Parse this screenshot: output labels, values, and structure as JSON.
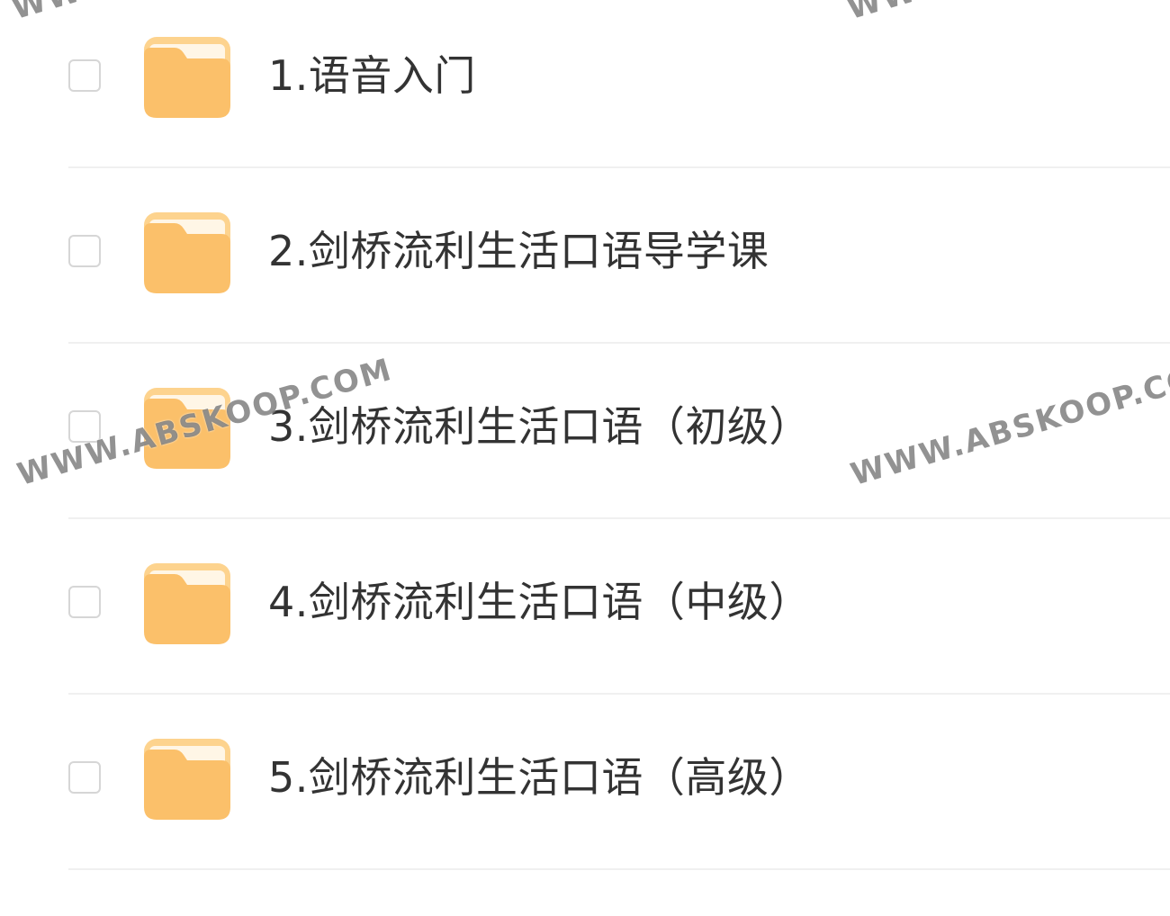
{
  "file_list": {
    "items": [
      {
        "name": "1.语音入门",
        "icon": "folder-icon",
        "checked": false
      },
      {
        "name": "2.剑桥流利生活口语导学课",
        "icon": "folder-icon",
        "checked": false
      },
      {
        "name": "3.剑桥流利生活口语（初级）",
        "icon": "folder-icon",
        "checked": false
      },
      {
        "name": "4.剑桥流利生活口语（中级）",
        "icon": "folder-icon",
        "checked": false
      },
      {
        "name": "5.剑桥流利生活口语（高级）",
        "icon": "folder-icon",
        "checked": false
      }
    ]
  },
  "watermarks": {
    "top_left": "WWW.ABSKOOP.COM",
    "top_right": "WWW.ABSKOOP.COM",
    "mid_left": "WWW.ABSKOOP.COM",
    "mid_right": "WWW.ABSKOOP.COM"
  },
  "colors": {
    "folder_body": "#FBC06A",
    "folder_tab": "#FDD38E",
    "folder_paper": "#FFF6E6",
    "text": "#333333",
    "checkbox_border": "#D6D6D6",
    "divider": "#F0F0F0",
    "watermark": "#6E6E6E"
  }
}
